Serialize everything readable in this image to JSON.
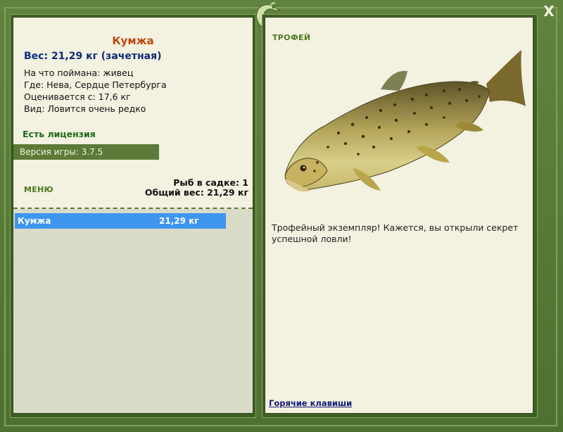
{
  "window": {
    "close_symbol": "X",
    "logo_icon": "fish-leaping-icon"
  },
  "left": {
    "fish_name": "Кумжа",
    "weight_line": "Вес: 21,29 кг (зачетная)",
    "info": [
      "На что поймана: живец",
      "Где: Нева, Сердце Петербурга",
      "Оценивается с: 17,6 кг",
      "Вид: Ловится очень редко"
    ],
    "license": "Есть лицензия",
    "version": "Версия игры: 3.7.5",
    "menu_label": "МЕНЮ",
    "stats": {
      "fish_count": "Рыб в садке: 1",
      "total_weight": "Общий вес: 21,29 кг"
    },
    "catch_list": [
      {
        "name": "Кумжа",
        "weight": "21,29 кг"
      }
    ]
  },
  "right": {
    "trophy_label": "ТРОФЕЙ",
    "trophy_text": "Трофейный экземпляр! Кажется, вы открыли секрет успешной ловли!",
    "hotkeys": "Горячие клавиши"
  },
  "colors": {
    "frame": "#5a7a3a",
    "panel": "#f3f1e0",
    "title": "#c0470f",
    "weight": "#0f2a7a",
    "selection": "#3d95f0"
  }
}
